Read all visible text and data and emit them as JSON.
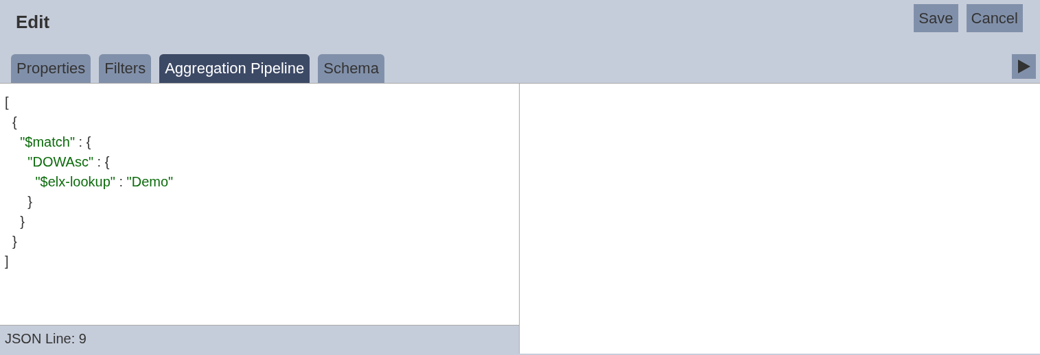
{
  "window": {
    "title": "Edit"
  },
  "buttons": [
    "Save",
    "Cancel"
  ],
  "tabs": [
    {
      "label": "Properties",
      "selected": false
    },
    {
      "label": "Filters",
      "selected": false
    },
    {
      "label": "Aggregation Pipeline",
      "selected": true
    },
    {
      "label": "Schema",
      "selected": false
    }
  ],
  "editor": {
    "lines": [
      [
        {
          "text": "[",
          "kind": "punct"
        }
      ],
      [
        {
          "text": "  {",
          "kind": "punct"
        }
      ],
      [
        {
          "text": "    \"$match\"",
          "kind": "string"
        },
        {
          "text": " : {",
          "kind": "punct"
        }
      ],
      [
        {
          "text": "      \"DOWAsc\"",
          "kind": "string"
        },
        {
          "text": " : {",
          "kind": "punct"
        }
      ],
      [
        {
          "text": "        \"$elx-lookup\"",
          "kind": "string"
        },
        {
          "text": " : ",
          "kind": "punct"
        },
        {
          "text": "\"Demo\"",
          "kind": "string"
        }
      ],
      [
        {
          "text": "      }",
          "kind": "punct"
        }
      ],
      [
        {
          "text": "    }",
          "kind": "punct"
        }
      ],
      [
        {
          "text": "  }",
          "kind": "punct"
        }
      ],
      [
        {
          "text": "]",
          "kind": "punct"
        }
      ]
    ],
    "status": "JSON Line: 9"
  }
}
